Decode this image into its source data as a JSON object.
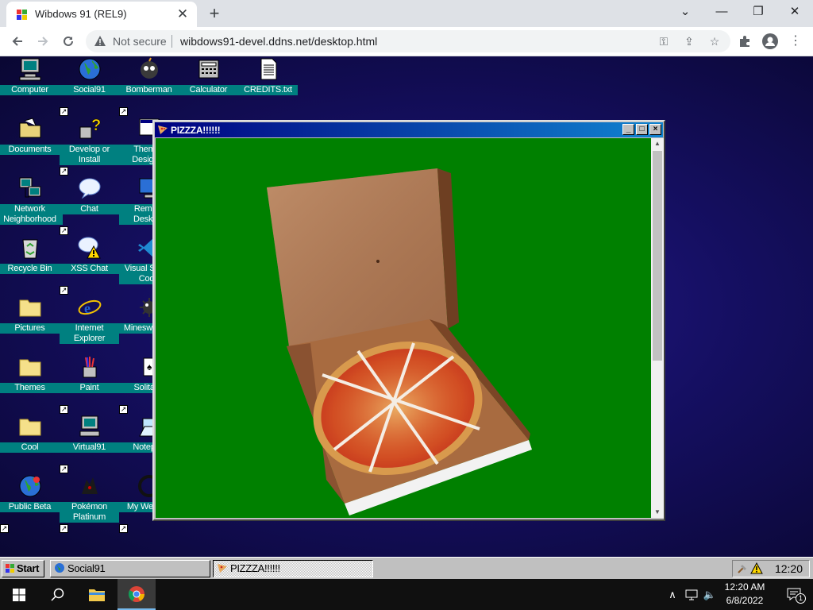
{
  "browser": {
    "tab_title": "Wibdows 91 (REL9)",
    "tab_close": "✕",
    "new_tab": "+",
    "security_label": "Not secure",
    "url": "wibdows91-devel.ddns.net/desktop.html",
    "window_controls": [
      "⌄",
      "—",
      "❐",
      "✕"
    ]
  },
  "desktop": {
    "icons": [
      {
        "label": "Computer",
        "icon": "computer-icon"
      },
      {
        "label": "Social91",
        "icon": "globe-icon"
      },
      {
        "label": "Bomberman",
        "icon": "bomberman-icon"
      },
      {
        "label": "Calculator",
        "icon": "calculator-icon"
      },
      {
        "label": "CREDITS.txt",
        "icon": "text-file-icon"
      },
      {
        "label": "Documents",
        "icon": "folder-open-icon"
      },
      {
        "label": "Develop or Install",
        "icon": "question-icon"
      },
      {
        "label": "Themes Designer",
        "icon": "themes-designer-icon"
      },
      {
        "label": "Network Neighborhood",
        "icon": "network-icon"
      },
      {
        "label": "Chat",
        "icon": "chat-bubble-icon"
      },
      {
        "label": "Remote Desktop",
        "icon": "remote-desktop-icon"
      },
      {
        "label": "Recycle Bin",
        "icon": "recycle-bin-icon"
      },
      {
        "label": "XSS Chat",
        "icon": "chat-warning-icon"
      },
      {
        "label": "Visual Studio Code",
        "icon": "vscode-icon"
      },
      {
        "label": "Pictures",
        "icon": "folder-icon"
      },
      {
        "label": "Internet Explorer",
        "icon": "internet-explorer-icon"
      },
      {
        "label": "Minesweeper",
        "icon": "minesweeper-icon"
      },
      {
        "label": "Themes",
        "icon": "folder-icon"
      },
      {
        "label": "Paint",
        "icon": "paint-icon"
      },
      {
        "label": "Solitaire",
        "icon": "solitaire-icon"
      },
      {
        "label": "Cool",
        "icon": "folder-icon"
      },
      {
        "label": "Virtual91",
        "icon": "virtual-computer-icon"
      },
      {
        "label": "Notepad",
        "icon": "notepad-icon"
      },
      {
        "label": "Public Beta",
        "icon": "globe-icon"
      },
      {
        "label": "Pokémon Platinum",
        "icon": "pokemon-icon"
      },
      {
        "label": "My Website",
        "icon": "website-icon"
      }
    ]
  },
  "window": {
    "title": "PIZZZA!!!!!!",
    "buttons": [
      "_",
      "□",
      "×"
    ],
    "image": "pizza-box-icon",
    "background_color": "#008000"
  },
  "w91_taskbar": {
    "start": "Start",
    "tasks": [
      "Social91",
      "PIZZZA!!!!!!"
    ],
    "clock": "12:20"
  },
  "win10": {
    "time": "12:20 AM",
    "date": "6/8/2022",
    "notification_count": "1"
  }
}
